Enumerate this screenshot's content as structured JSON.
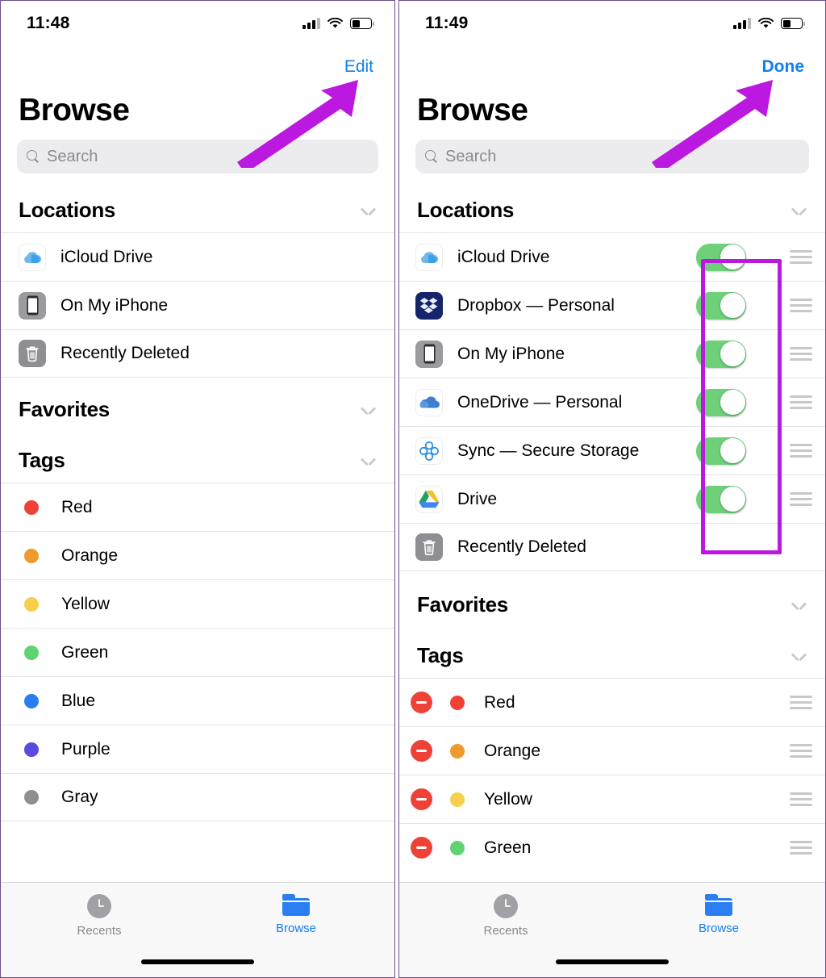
{
  "theme": {
    "accent_blue": "#1080f0",
    "toggle_green": "#6fd07a",
    "delete_red": "#ef4136",
    "annotation_purple": "#bb18e0",
    "search_bg": "#ececee"
  },
  "left_screen": {
    "status_bar": {
      "time": "11:48",
      "signal_icon": "cellular-signal-icon",
      "wifi_icon": "wifi-icon",
      "battery_icon": "battery-icon"
    },
    "nav": {
      "action_label": "Edit"
    },
    "title": "Browse",
    "search": {
      "placeholder": "Search",
      "value": "",
      "icon": "search-icon"
    },
    "sections": [
      {
        "title": "Locations",
        "collapsed_icon": "chevron-down-icon",
        "rows": [
          {
            "label": "iCloud Drive",
            "icon": "icloud-drive-icon"
          },
          {
            "label": "On My iPhone",
            "icon": "iphone-icon"
          },
          {
            "label": "Recently Deleted",
            "icon": "trash-icon"
          }
        ]
      },
      {
        "title": "Favorites",
        "collapsed_icon": "chevron-down-icon",
        "rows": []
      },
      {
        "title": "Tags",
        "collapsed_icon": "chevron-down-icon",
        "rows": [
          {
            "label": "Red",
            "color": "#ef4136"
          },
          {
            "label": "Orange",
            "color": "#ef9a2c"
          },
          {
            "label": "Yellow",
            "color": "#f7cf4a"
          },
          {
            "label": "Green",
            "color": "#5fd271"
          },
          {
            "label": "Blue",
            "color": "#2a7ef0"
          },
          {
            "label": "Purple",
            "color": "#5b4ae0"
          },
          {
            "label": "Gray",
            "color": "#8e8e93"
          }
        ]
      }
    ],
    "tabs": [
      {
        "label": "Recents",
        "icon": "clock-icon",
        "active": false
      },
      {
        "label": "Browse",
        "icon": "folder-icon",
        "active": true
      }
    ]
  },
  "right_screen": {
    "status_bar": {
      "time": "11:49",
      "signal_icon": "cellular-signal-icon",
      "wifi_icon": "wifi-icon",
      "battery_icon": "battery-icon"
    },
    "nav": {
      "action_label": "Done"
    },
    "title": "Browse",
    "search": {
      "placeholder": "Search",
      "value": "",
      "icon": "search-icon"
    },
    "sections": [
      {
        "title": "Locations",
        "collapsed_icon": "chevron-down-icon",
        "rows": [
          {
            "label": "iCloud Drive",
            "icon": "icloud-drive-icon",
            "toggle": "on",
            "reorder": true
          },
          {
            "label": "Dropbox — Personal",
            "icon": "dropbox-icon",
            "toggle": "on",
            "reorder": true
          },
          {
            "label": "On My iPhone",
            "icon": "iphone-icon",
            "toggle": "on",
            "reorder": true
          },
          {
            "label": "OneDrive — Personal",
            "icon": "onedrive-icon",
            "toggle": "on",
            "reorder": true
          },
          {
            "label": "Sync — Secure Storage",
            "icon": "sync-icon",
            "toggle": "on",
            "reorder": true
          },
          {
            "label": "Drive",
            "icon": "google-drive-icon",
            "toggle": "on",
            "reorder": true
          },
          {
            "label": "Recently Deleted",
            "icon": "trash-icon",
            "toggle": null,
            "reorder": false
          }
        ]
      },
      {
        "title": "Favorites",
        "collapsed_icon": "chevron-down-icon",
        "rows": []
      },
      {
        "title": "Tags",
        "collapsed_icon": "chevron-down-icon",
        "rows": [
          {
            "label": "Red",
            "color": "#ef4136",
            "delete": true,
            "reorder": true
          },
          {
            "label": "Orange",
            "color": "#ef9a2c",
            "delete": true,
            "reorder": true
          },
          {
            "label": "Yellow",
            "color": "#f7cf4a",
            "delete": true,
            "reorder": true
          },
          {
            "label": "Green",
            "color": "#5fd271",
            "delete": true,
            "reorder": true
          }
        ]
      }
    ],
    "tabs": [
      {
        "label": "Recents",
        "icon": "clock-icon",
        "active": false
      },
      {
        "label": "Browse",
        "icon": "folder-icon",
        "active": true
      }
    ]
  },
  "annotations": [
    {
      "type": "arrow",
      "target": "Edit",
      "color": "#bb18e0"
    },
    {
      "type": "arrow",
      "target": "Done",
      "color": "#bb18e0"
    },
    {
      "type": "highlight-box",
      "target": "location-toggles-column",
      "color": "#bb18e0"
    }
  ]
}
